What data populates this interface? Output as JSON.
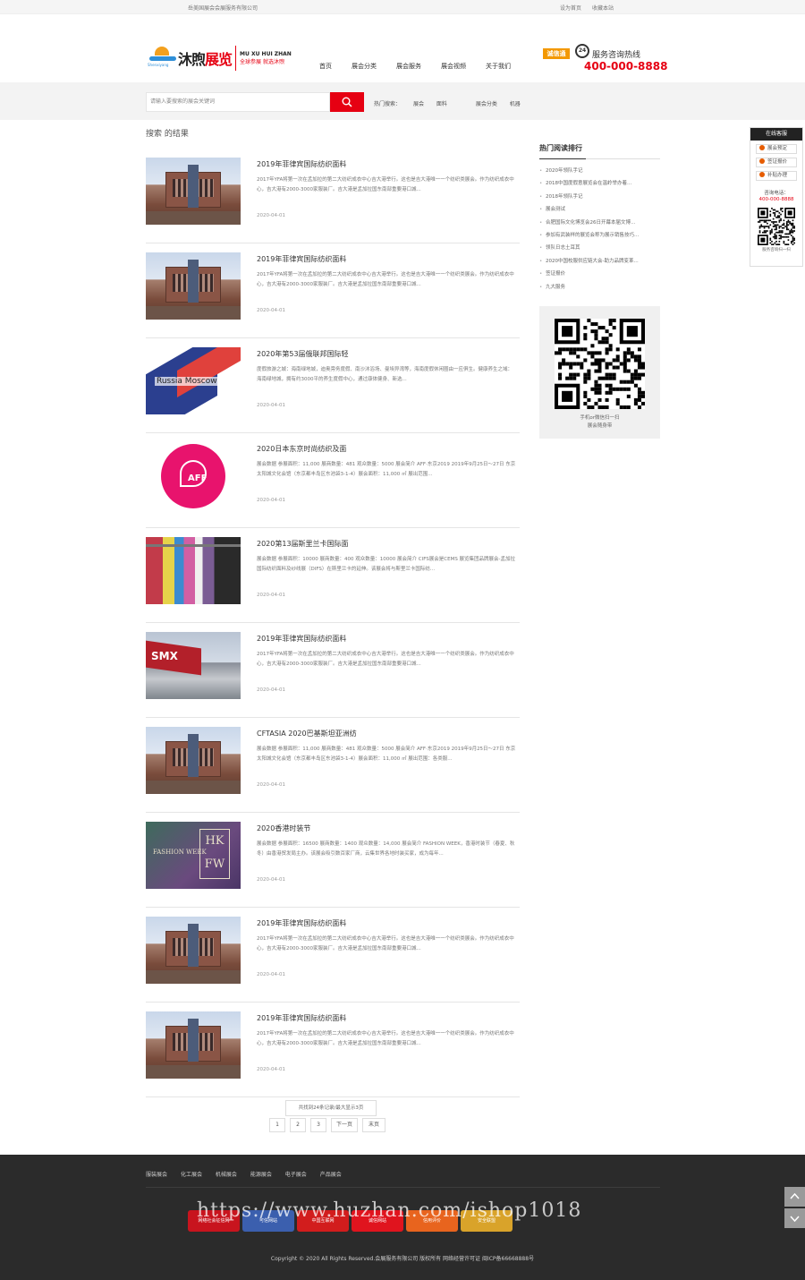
{
  "topbar": {
    "company": "岳美国展会会展服务有限公司",
    "links": [
      "设为首页",
      "收藏本站"
    ]
  },
  "header": {
    "logo_cn_a": "沐煦",
    "logo_cn_b": "展览",
    "logo_sub": "Shenxiyang",
    "logo_en": "MU XU HUI ZHAN",
    "logo_slogan": "全球参展 就选沐煦",
    "nav": [
      "首页",
      "展会分类",
      "展会服务",
      "展会视频",
      "关于我们"
    ],
    "hotline_badge": "诚信通",
    "hotline_icon": "24",
    "hotline_label": "服务咨询热线",
    "hotline_number": "400-000-8888"
  },
  "search": {
    "placeholder": "请输入要搜索的展会关键词",
    "hot_label": "热门搜索：",
    "hot_words": [
      "展会",
      "面料",
      "展会分类",
      "机器"
    ]
  },
  "main": {
    "breadcrumb": "搜索 的结果",
    "items": [
      {
        "title": "2019年菲律宾国际纺织面料",
        "desc": "2017年YFA将第一次在孟加拉的第二大纺织成衣中心吉大港举行。这也是吉大港唯一一个纺织类展会。作为纺织成衣中心，吉大港有2000-3000家服装厂。吉大港是孟加拉国东南部重要港口城...",
        "date": "2020-04-01",
        "thumb": "building"
      },
      {
        "title": "2019年菲律宾国际纺织面料",
        "desc": "2017年YFA将第一次在孟加拉的第二大纺织成衣中心吉大港举行。这也是吉大港唯一一个纺织类展会。作为纺织成衣中心，吉大港有2000-3000家服装厂。吉大港是孟加拉国东南部重要港口城...",
        "date": "2020-04-01",
        "thumb": "building"
      },
      {
        "title": "2020年第53届俄联邦国际轻",
        "desc": "度假旅游之城：海南绿地城，迪奥旁务度假、南沙沐浴场、曼埃异湾等，海南度假休闲圈由一应俱生。健康养生之域：海南绿地城，拥有约3000平的养生度假中心，通过康体健身、新选...",
        "date": "2020-04-01",
        "thumb": "russia",
        "thumb_text": "Russia Moscow"
      },
      {
        "title": "2020日本东京时尚纺织及面",
        "desc": "展会数据 参展面积：11,000 展商数量：481 观众数量：5000 展会简介 AFF·东京2019 2019年9月25日～27日 东京太阳城文化会馆（东京都丰岛区东池袋3-1-4）展会面积：11,000 ㎡ 展出范围...",
        "date": "2020-04-01",
        "thumb": "aff",
        "thumb_text": "AFF"
      },
      {
        "title": "2020第13届斯里兰卡国际面",
        "desc": "展会数据 参展面积：10000 展商数量：400 观众数量：10000 展会简介 CIFS展会是CEMS 展览集团品牌展会-孟加拉国际纺织面料及纱线展（DIFS）在斯里兰卡的延伸。该展会将与斯里兰卡国际纺...",
        "date": "2020-04-01",
        "thumb": "fabric"
      },
      {
        "title": "2019年菲律宾国际纺织面料",
        "desc": "2017年YFA将第一次在孟加拉的第二大纺织成衣中心吉大港举行。这也是吉大港唯一一个纺织类展会。作为纺织成衣中心，吉大港有2000-3000家服装厂。吉大港是孟加拉国东南部重要港口城...",
        "date": "2020-04-01",
        "thumb": "smx",
        "thumb_text": "SMX"
      },
      {
        "title": "CFTASIA 2020巴基斯坦亚洲纺",
        "desc": "展会数据 参展面积：11,000 展商数量：481 观众数量：5000 展会简介 AFF·东京2019 2019年9月25日～27日 东京太阳城文化会馆（东京都丰岛区东池袋3-1-4）展会面积：11,000 ㎡ 展出范围：各类服...",
        "date": "2020-04-01",
        "thumb": "building"
      },
      {
        "title": "2020香港时装节",
        "desc": "展会数据 参展面积：16500 展商数量：1400 观众数量：14,000 展会简介 FASHION WEEK，香港时装节（春夏、秋冬）由香港贸发局主办。该展会吸引数百家厂商，云集世界各地时装买家，成为每年...",
        "date": "2020-04-01",
        "thumb": "fashion",
        "thumb_text": "FASHION WEEK",
        "thumb_text2": "HK FW"
      },
      {
        "title": "2019年菲律宾国际纺织面料",
        "desc": "2017年YFA将第一次在孟加拉的第二大纺织成衣中心吉大港举行。这也是吉大港唯一一个纺织类展会。作为纺织成衣中心，吉大港有2000-3000家服装厂。吉大港是孟加拉国东南部重要港口城...",
        "date": "2020-04-01",
        "thumb": "building"
      },
      {
        "title": "2019年菲律宾国际纺织面料",
        "desc": "2017年YFA将第一次在孟加拉的第二大纺织成衣中心吉大港举行。这也是吉大港唯一一个纺织类展会。作为纺织成衣中心，吉大港有2000-3000家服装厂。吉大港是孟加拉国东南部重要港口城...",
        "date": "2020-04-01",
        "thumb": "building"
      }
    ]
  },
  "pager": {
    "info": "共找到24条记录/最大显示3页",
    "pages": [
      "1",
      "2",
      "3"
    ],
    "next": "下一页",
    "last": "末页"
  },
  "sidebar": {
    "title": "热门阅读排行",
    "items": [
      "2020年领队手记",
      "2018中国度假意展览会在温岭举办着...",
      "2018年领队手记",
      "展会测试",
      "合肥国际文化博览会26日开幕本届文博...",
      "参加有武装样的展览会称为展示销售技巧...",
      "领队日志土耳其",
      "2020中国校服供应链大会-助力品牌变革...",
      "签证报价",
      "九大服务"
    ],
    "qr_caption": [
      "手机or微信扫一扫",
      "展会随身带"
    ]
  },
  "float_panel": {
    "title": "在线客服",
    "buttons": [
      "展会预定",
      "签证报价",
      "补贴办理"
    ],
    "tel_label": "咨询电话：",
    "tel": "400-000-8888",
    "qr_caption": "服务咨询扫一扫"
  },
  "footer": {
    "links": [
      "服装展会",
      "化工展会",
      "机械展会",
      "能源展会",
      "电子展会",
      "产品展会"
    ],
    "badges": [
      {
        "label": "网络社会征信网",
        "color": "#c8141e"
      },
      {
        "label": "可信网站",
        "color": "#3b5fae"
      },
      {
        "label": "中国互联网",
        "color": "#d21d1d"
      },
      {
        "label": "诚信网站",
        "color": "#e0141e"
      },
      {
        "label": "信用评价",
        "color": "#e8641e"
      },
      {
        "label": "安全联盟",
        "color": "#d9a32a"
      }
    ],
    "watermark": "https://www.huzhan.com/ishop1018",
    "copyright": "Copyright © 2020 All Rights Reserved.会展服务有限公司 版权所有    网络经营许可证    闽ICP备66668888号"
  }
}
